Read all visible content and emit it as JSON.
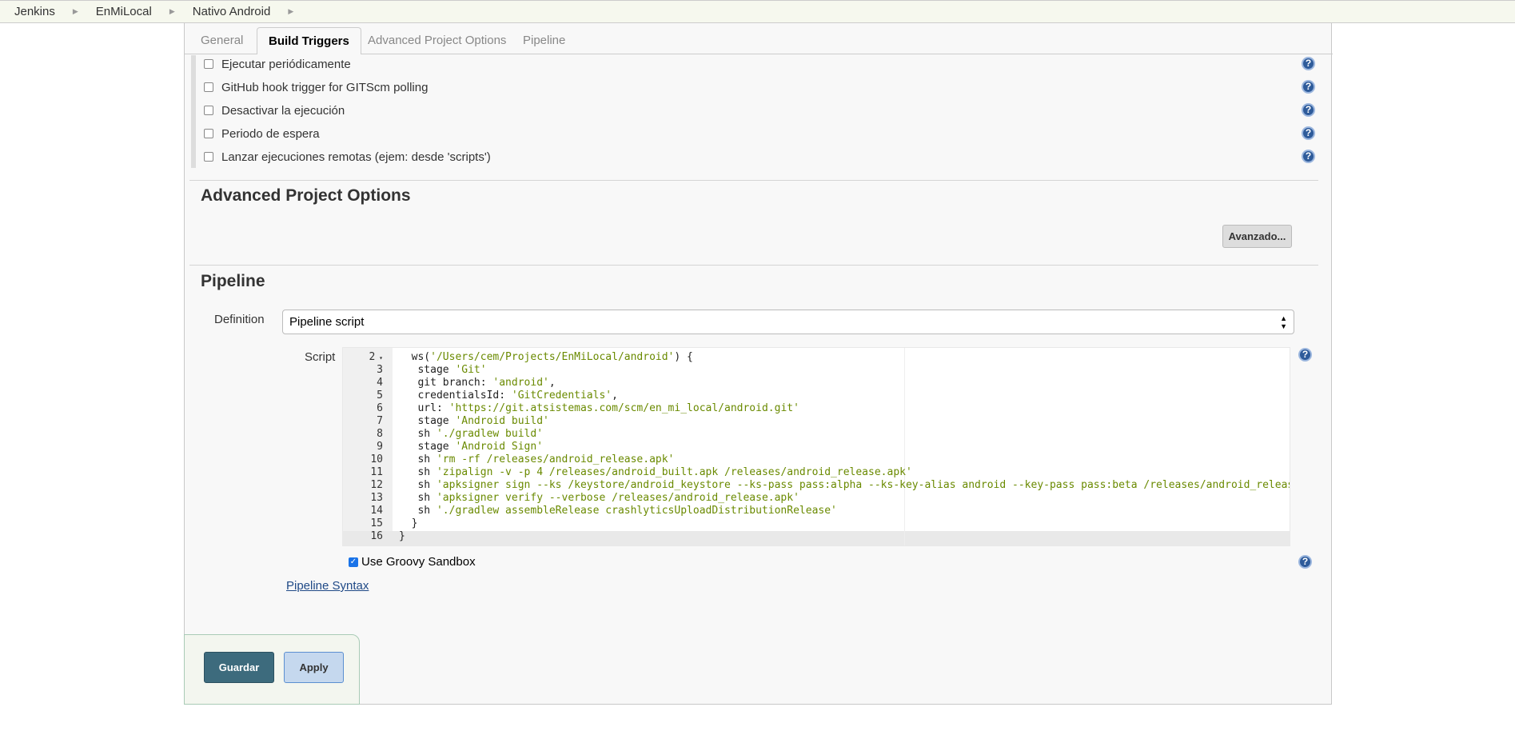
{
  "breadcrumb": [
    "Jenkins",
    "EnMiLocal",
    "Nativo Android"
  ],
  "tabs": [
    {
      "label": "General"
    },
    {
      "label": "Build Triggers",
      "active": true
    },
    {
      "label": "Advanced Project Options"
    },
    {
      "label": "Pipeline"
    }
  ],
  "triggers": [
    {
      "label": "Ejecutar periódicamente",
      "checked": false
    },
    {
      "label": "GitHub hook trigger for GITScm polling",
      "checked": false
    },
    {
      "label": "Desactivar la ejecución",
      "checked": false
    },
    {
      "label": "Periodo de espera",
      "checked": false
    },
    {
      "label": "Lanzar ejecuciones remotas (ejem: desde 'scripts')",
      "checked": false
    }
  ],
  "advanced": {
    "title": "Advanced Project Options",
    "button": "Avanzado..."
  },
  "pipeline": {
    "title": "Pipeline",
    "definition_label": "Definition",
    "definition_value": "Pipeline script",
    "script_label": "Script",
    "lines": [
      {
        "n": "2",
        "pre": "  ws(",
        "str": "'/Users/cem/Projects/EnMiLocal/android'",
        "post": ") {",
        "fold": true
      },
      {
        "n": "3",
        "pre": "   stage ",
        "str": "'Git'",
        "post": ""
      },
      {
        "n": "4",
        "pre": "   git branch: ",
        "str": "'android'",
        "post": ","
      },
      {
        "n": "5",
        "pre": "   credentialsId: ",
        "str": "'GitCredentials'",
        "post": ","
      },
      {
        "n": "6",
        "pre": "   url: ",
        "str": "'https://git.atsistemas.com/scm/en_mi_local/android.git'",
        "post": ""
      },
      {
        "n": "7",
        "pre": "   stage ",
        "str": "'Android build'",
        "post": ""
      },
      {
        "n": "8",
        "pre": "   sh ",
        "str": "'./gradlew build'",
        "post": ""
      },
      {
        "n": "9",
        "pre": "   stage ",
        "str": "'Android Sign'",
        "post": ""
      },
      {
        "n": "10",
        "pre": "   sh ",
        "str": "'rm -rf /releases/android_release.apk'",
        "post": ""
      },
      {
        "n": "11",
        "pre": "   sh ",
        "str": "'zipalign -v -p 4 /releases/android_built.apk /releases/android_release.apk'",
        "post": ""
      },
      {
        "n": "12",
        "pre": "   sh ",
        "str": "'apksigner sign --ks /keystore/android_keystore --ks-pass pass:alpha --ks-key-alias android --key-pass pass:beta /releases/android_release.apk'",
        "post": ""
      },
      {
        "n": "13",
        "pre": "   sh ",
        "str": "'apksigner verify --verbose /releases/android_release.apk'",
        "post": ""
      },
      {
        "n": "14",
        "pre": "   sh ",
        "str": "'./gradlew assembleRelease crashlyticsUploadDistributionRelease'",
        "post": ""
      },
      {
        "n": "15",
        "pre": "  }",
        "str": "",
        "post": ""
      },
      {
        "n": "16",
        "pre": "}",
        "str": "",
        "post": ""
      }
    ],
    "sandbox_label": "Use Groovy Sandbox",
    "sandbox_checked": true,
    "syntax_link": "Pipeline Syntax"
  },
  "buttons": {
    "save": "Guardar",
    "apply": "Apply"
  },
  "colors": {
    "save_bg": "#3d6b7d",
    "apply_bg": "#c5d8ee",
    "string": "#6a8a00",
    "help": "#2e5b9a"
  }
}
